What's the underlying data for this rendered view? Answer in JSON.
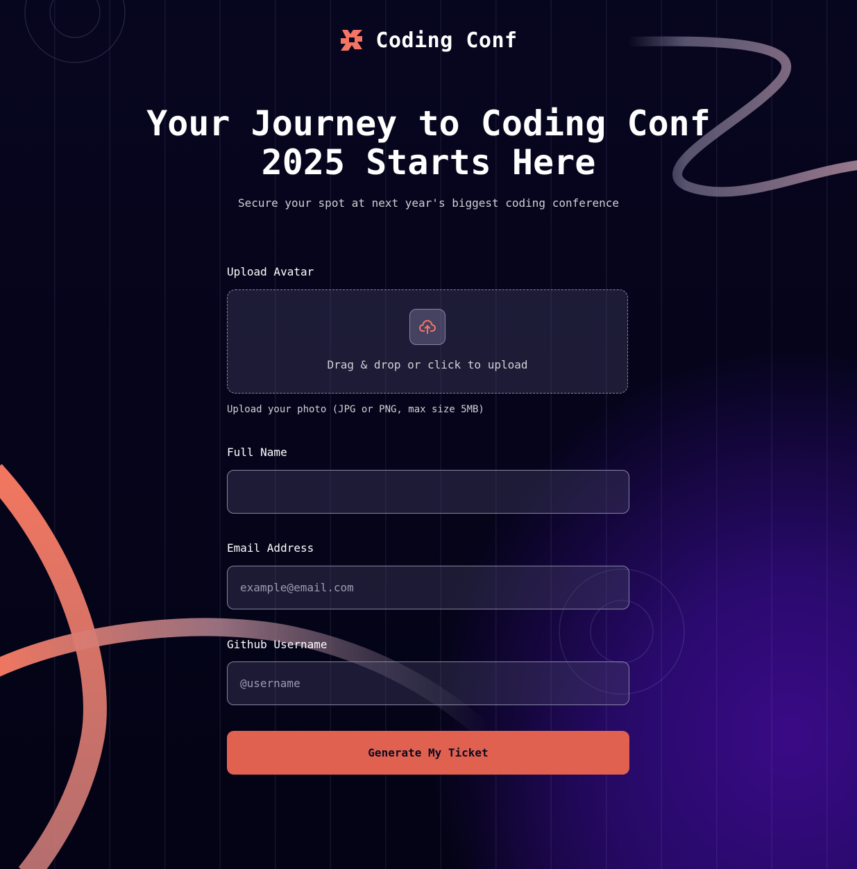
{
  "brand": {
    "name": "Coding Conf",
    "logo_icon": "coding-conf-logo-icon"
  },
  "hero": {
    "title_line1": "Your Journey to Coding Conf",
    "title_line2": "2025 Starts Here",
    "subtitle": "Secure your spot at next year's biggest coding conference"
  },
  "form": {
    "avatar_label": "Upload Avatar",
    "upload_icon": "cloud-upload-icon",
    "drop_text": "Drag & drop or click to upload",
    "avatar_hint": "Upload your photo (JPG or PNG, max size 5MB)",
    "name_label": "Full Name",
    "name_value": "",
    "name_placeholder": "",
    "email_label": "Email Address",
    "email_value": "",
    "email_placeholder": "example@email.com",
    "github_label": "Github Username",
    "github_value": "",
    "github_placeholder": "@username",
    "submit_label": "Generate My Ticket"
  },
  "colors": {
    "accent": "#e16151",
    "background": "#07061f",
    "purple_glow": "#3a0a86",
    "text_muted": "#d2d1d6",
    "field_border": "#8784a4"
  }
}
